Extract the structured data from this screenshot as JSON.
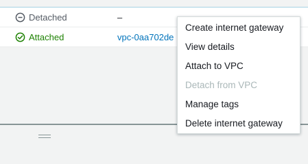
{
  "rows": [
    {
      "status": "Detached",
      "status_icon": "minus-circle-icon",
      "vpc": "–"
    },
    {
      "status": "Attached",
      "status_icon": "check-circle-icon",
      "vpc": "vpc-0aa702de"
    }
  ],
  "colors": {
    "attached": "#1d8102",
    "detached": "#545b64",
    "link": "#0073bb",
    "disabled": "#aab7b8"
  },
  "menu": {
    "items": [
      {
        "label": "Create internet gateway",
        "enabled": true
      },
      {
        "label": "View details",
        "enabled": true
      },
      {
        "label": "Attach to VPC",
        "enabled": true
      },
      {
        "label": "Detach from VPC",
        "enabled": false
      },
      {
        "label": "Manage tags",
        "enabled": true
      },
      {
        "label": "Delete internet gateway",
        "enabled": true
      }
    ]
  }
}
